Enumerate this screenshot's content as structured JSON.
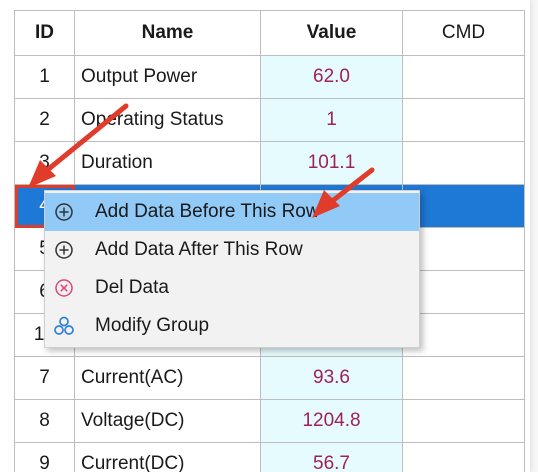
{
  "table": {
    "headers": {
      "id": "ID",
      "name": "Name",
      "value": "Value",
      "cmd": "CMD"
    },
    "rows": [
      {
        "id": "1",
        "name": "Output Power",
        "value": "62.0"
      },
      {
        "id": "2",
        "name": "Operating Status",
        "value": "1"
      },
      {
        "id": "3",
        "name": "Duration",
        "value": "101.1"
      },
      {
        "id": "4",
        "name": "",
        "value": ""
      },
      {
        "id": "5",
        "name": "",
        "value": ""
      },
      {
        "id": "6",
        "name": "",
        "value": ""
      },
      {
        "id": "10",
        "name": "",
        "value": ""
      },
      {
        "id": "7",
        "name": "Current(AC)",
        "value": "93.6"
      },
      {
        "id": "8",
        "name": "Voltage(DC)",
        "value": "1204.8"
      },
      {
        "id": "9",
        "name": "Current(DC)",
        "value": "56.7"
      }
    ]
  },
  "context_menu": {
    "items": [
      {
        "label": "Add Data Before This Row",
        "icon": "plus-circle-icon"
      },
      {
        "label": "Add Data After This Row",
        "icon": "plus-circle-icon"
      },
      {
        "label": "Del Data",
        "icon": "x-circle-icon"
      },
      {
        "label": "Modify Group",
        "icon": "group-icon"
      }
    ]
  },
  "colors": {
    "value_cell_bg": "#e6fbfd",
    "value_text": "#a0215a",
    "selection": "#1e78d6",
    "menu_hover": "#91c9f7",
    "annotation_red": "#e03c2c"
  }
}
